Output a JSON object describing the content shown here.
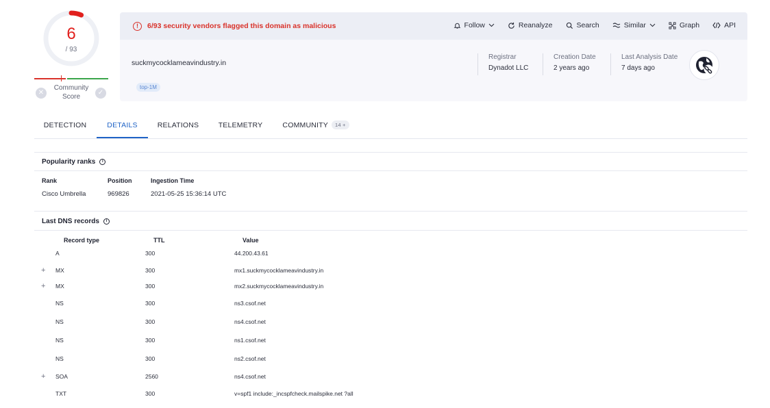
{
  "score": {
    "detections": "6",
    "total": "/ 93",
    "ratio": 0.0645,
    "community_label_1": "Community",
    "community_label_2": "Score",
    "colors": {
      "malicious": "#e1201d",
      "harmless": "#3aa54a",
      "track": "#eef0f5"
    }
  },
  "alert": {
    "icon": "alert-circle-icon",
    "text": "6/93 security vendors flagged this domain as malicious"
  },
  "actions": [
    {
      "label": "Follow",
      "icon": "bell-icon",
      "dropdown": true
    },
    {
      "label": "Reanalyze",
      "icon": "refresh-icon",
      "dropdown": false
    },
    {
      "label": "Search",
      "icon": "search-icon",
      "dropdown": false
    },
    {
      "label": "Similar",
      "icon": "similar-icon",
      "dropdown": true
    },
    {
      "label": "Graph",
      "icon": "graph-icon",
      "dropdown": false
    },
    {
      "label": "API",
      "icon": "code-icon",
      "dropdown": false
    }
  ],
  "domain": {
    "name": "suckmycocklameavindustry.in",
    "tag": "top-1M"
  },
  "meta": {
    "registrar_label": "Registrar",
    "registrar_value": "Dynadot LLC",
    "creation_label": "Creation Date",
    "creation_value": "2 years ago",
    "analysis_label": "Last Analysis Date",
    "analysis_value": "7 days ago"
  },
  "tabs": {
    "detection": "DETECTION",
    "details": "DETAILS",
    "relations": "RELATIONS",
    "telemetry": "TELEMETRY",
    "community": "COMMUNITY",
    "community_badge": "14 +"
  },
  "popularity": {
    "title": "Popularity ranks",
    "headers": {
      "rank": "Rank",
      "position": "Position",
      "ingestion": "Ingestion Time"
    },
    "rows": [
      {
        "rank": "Cisco Umbrella",
        "position": "969826",
        "ingestion": "2021-05-25 15:36:14 UTC"
      }
    ]
  },
  "dns": {
    "title": "Last DNS records",
    "headers": {
      "type": "Record type",
      "ttl": "TTL",
      "value": "Value"
    },
    "rows": [
      {
        "expandable": false,
        "type": "A",
        "ttl": "300",
        "value": "44.200.43.61"
      },
      {
        "expandable": true,
        "type": "MX",
        "ttl": "300",
        "value": "mx1.suckmycocklameavindustry.in"
      },
      {
        "expandable": true,
        "type": "MX",
        "ttl": "300",
        "value": "mx2.suckmycocklameavindustry.in"
      },
      {
        "expandable": false,
        "type": "NS",
        "ttl": "300",
        "value": "ns3.csof.net"
      },
      {
        "expandable": false,
        "type": "NS",
        "ttl": "300",
        "value": "ns4.csof.net"
      },
      {
        "expandable": false,
        "type": "NS",
        "ttl": "300",
        "value": "ns1.csof.net"
      },
      {
        "expandable": false,
        "type": "NS",
        "ttl": "300",
        "value": "ns2.csof.net"
      },
      {
        "expandable": true,
        "type": "SOA",
        "ttl": "2560",
        "value": "ns4.csof.net"
      },
      {
        "expandable": false,
        "type": "TXT",
        "ttl": "300",
        "value": "v=spf1 include:_incspfcheck.mailspike.net ?all"
      }
    ]
  }
}
